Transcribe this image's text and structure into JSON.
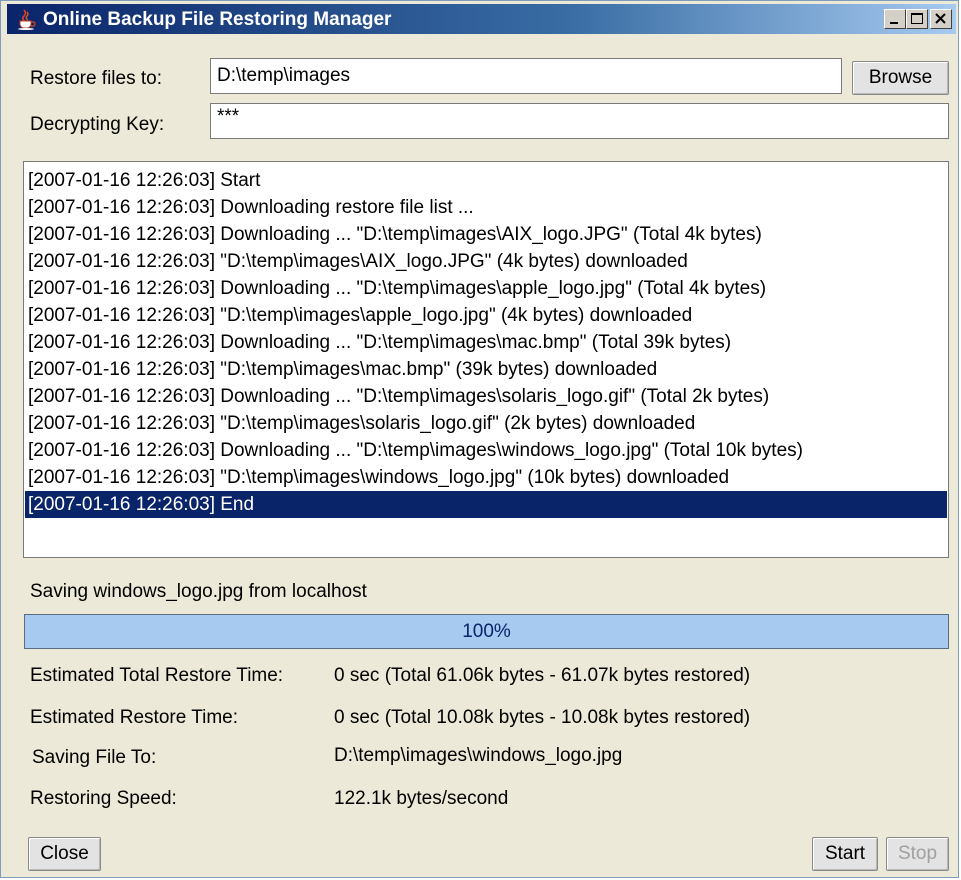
{
  "window": {
    "title": "Online Backup File Restoring Manager"
  },
  "form": {
    "restore_label": "Restore files to:",
    "restore_value": "D:\\temp\\images",
    "browse_label": "Browse",
    "key_label": "Decrypting Key:",
    "key_value": "***"
  },
  "log": {
    "entries": [
      "[2007-01-16 12:26:03] Start",
      "[2007-01-16 12:26:03] Downloading restore file list ...",
      "[2007-01-16 12:26:03] Downloading ... \"D:\\temp\\images\\AIX_logo.JPG\" (Total 4k bytes)",
      "[2007-01-16 12:26:03] \"D:\\temp\\images\\AIX_logo.JPG\" (4k bytes) downloaded",
      "[2007-01-16 12:26:03] Downloading ... \"D:\\temp\\images\\apple_logo.jpg\" (Total 4k bytes)",
      "[2007-01-16 12:26:03] \"D:\\temp\\images\\apple_logo.jpg\" (4k bytes) downloaded",
      "[2007-01-16 12:26:03] Downloading ... \"D:\\temp\\images\\mac.bmp\" (Total 39k bytes)",
      "[2007-01-16 12:26:03] \"D:\\temp\\images\\mac.bmp\" (39k bytes) downloaded",
      "[2007-01-16 12:26:03] Downloading ... \"D:\\temp\\images\\solaris_logo.gif\" (Total 2k bytes)",
      "[2007-01-16 12:26:03] \"D:\\temp\\images\\solaris_logo.gif\" (2k bytes) downloaded",
      "[2007-01-16 12:26:03] Downloading ... \"D:\\temp\\images\\windows_logo.jpg\" (Total 10k bytes)",
      "[2007-01-16 12:26:03] \"D:\\temp\\images\\windows_logo.jpg\" (10k bytes) downloaded",
      "[2007-01-16 12:26:03] End"
    ],
    "selected_index": 12
  },
  "status": {
    "text": "Saving windows_logo.jpg from localhost"
  },
  "progress": {
    "value": 100,
    "label": "100%"
  },
  "info": {
    "total_time_label": "Estimated Total Restore Time:",
    "total_time_value": "0 sec (Total 61.06k bytes - 61.07k bytes restored)",
    "time_label": "Estimated Restore Time:",
    "time_value": "0 sec (Total 10.08k bytes - 10.08k bytes restored)",
    "saving_to_label": "Saving File To:",
    "saving_to_value": "D:\\temp\\images\\windows_logo.jpg",
    "speed_label": "Restoring Speed:",
    "speed_value": "122.1k bytes/second"
  },
  "buttons": {
    "close": "Close",
    "start": "Start",
    "stop": "Stop"
  },
  "colors": {
    "titlebar": "#0a246a",
    "selection": "#0a246a",
    "progress": "#a6caf0"
  },
  "icons": {
    "app": "java-coffee-icon",
    "minimize": "minimize-icon",
    "maximize": "maximize-icon",
    "close": "close-icon"
  }
}
